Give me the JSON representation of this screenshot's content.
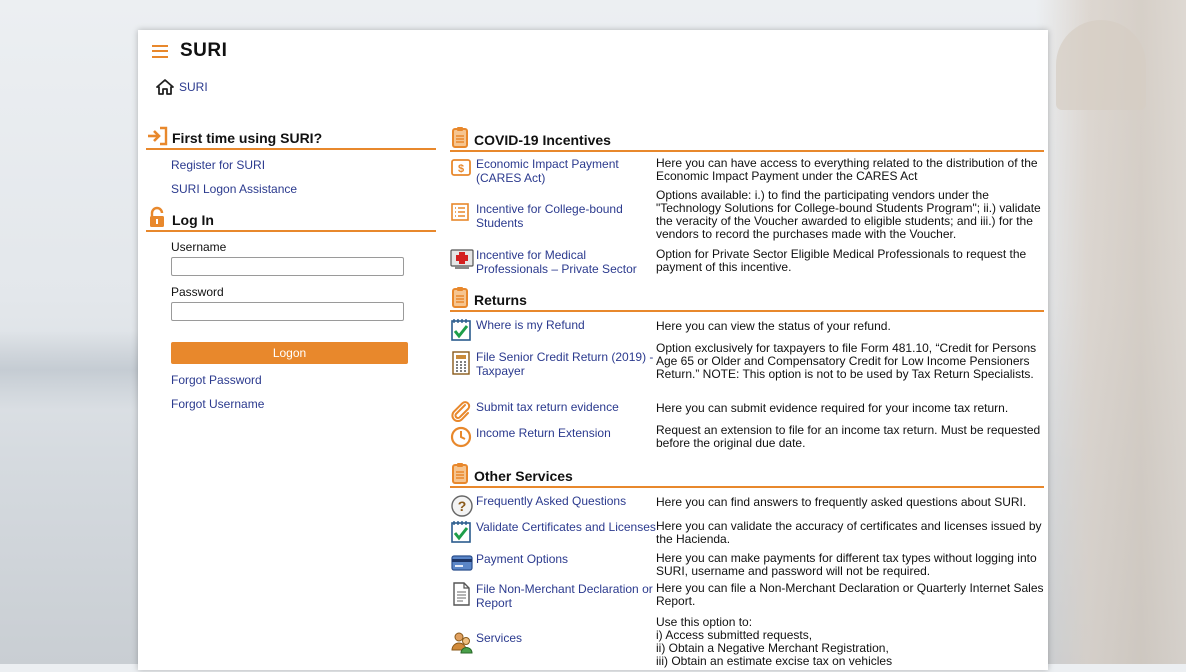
{
  "app": {
    "title": "SURI"
  },
  "breadcrumb": {
    "home_label": "SURI"
  },
  "first_time": {
    "title": "First time using SURI?",
    "links": [
      "Register for SURI",
      "SURI Logon Assistance"
    ]
  },
  "login": {
    "title": "Log In",
    "username_label": "Username",
    "username_value": "",
    "password_label": "Password",
    "password_value": "",
    "logon_label": "Logon",
    "forgot_password": "Forgot Password",
    "forgot_username": "Forgot Username"
  },
  "covid": {
    "title": "COVID-19 Incentives",
    "items": [
      {
        "link": "Economic Impact Payment (CARES Act)",
        "desc": "Here you can have access to everything related to the distribution of the Economic Impact Payment under the CARES Act",
        "icon": "dollar-icon"
      },
      {
        "link": "Incentive for College-bound Students",
        "desc": "Options available: i.) to find the participating vendors under the \"Technology Solutions for College-bound Students Program\"; ii.) validate the veracity of the Voucher awarded to eligible students; and iii.) for the vendors to record the purchases made with the Voucher.",
        "icon": "list-icon"
      },
      {
        "link": "Incentive for Medical Professionals – Private Sector",
        "desc": "Option for Private Sector Eligible Medical Professionals to request the payment of this incentive.",
        "icon": "medical-icon"
      }
    ]
  },
  "returns": {
    "title": "Returns",
    "items": [
      {
        "link": "Where is my Refund",
        "desc": "Here you can view the status of your refund.",
        "icon": "checklist-icon"
      },
      {
        "link": "File Senior Credit Return (2019) - Taxpayer",
        "desc": "Option exclusively for taxpayers to file Form 481.10, “Credit for Persons Age 65 or Older and Compensatory Credit for Low Income Pensioners Return.” NOTE: This option is not to be used by Tax Return Specialists.",
        "icon": "calculator-icon"
      },
      {
        "link": "Submit tax return evidence",
        "desc": "Here you can submit evidence required for your income tax return.",
        "icon": "paperclip-icon"
      },
      {
        "link": "Income Return Extension",
        "desc": "Request an extension to file for an income tax return. Must be requested before the original due date.",
        "icon": "clock-icon"
      }
    ]
  },
  "other": {
    "title": "Other Services",
    "items": [
      {
        "link": "Frequently Asked Questions",
        "desc": "Here you can find answers to frequently asked questions about SURI.",
        "icon": "question-icon"
      },
      {
        "link": "Validate Certificates and Licenses",
        "desc": "Here you can validate the accuracy of certificates and licenses issued by the Hacienda.",
        "icon": "checklist-icon"
      },
      {
        "link": "Payment Options",
        "desc": "Here you can make payments for different tax types without logging into SURI, username and password will not be required.",
        "icon": "card-icon"
      },
      {
        "link": "File Non-Merchant Declaration or Report",
        "desc": "Here you can file a Non-Merchant Declaration or Quarterly Internet Sales Report.",
        "icon": "document-icon"
      },
      {
        "link": "Services",
        "desc_lines": [
          "Use this option to:",
          "i) Access submitted requests,",
          "ii) Obtain a Negative Merchant Registration,",
          "iii) Obtain an estimate excise tax on vehicles"
        ],
        "icon": "people-icon"
      }
    ]
  },
  "colors": {
    "accent": "#e8882c",
    "link": "#2b3a8e"
  }
}
